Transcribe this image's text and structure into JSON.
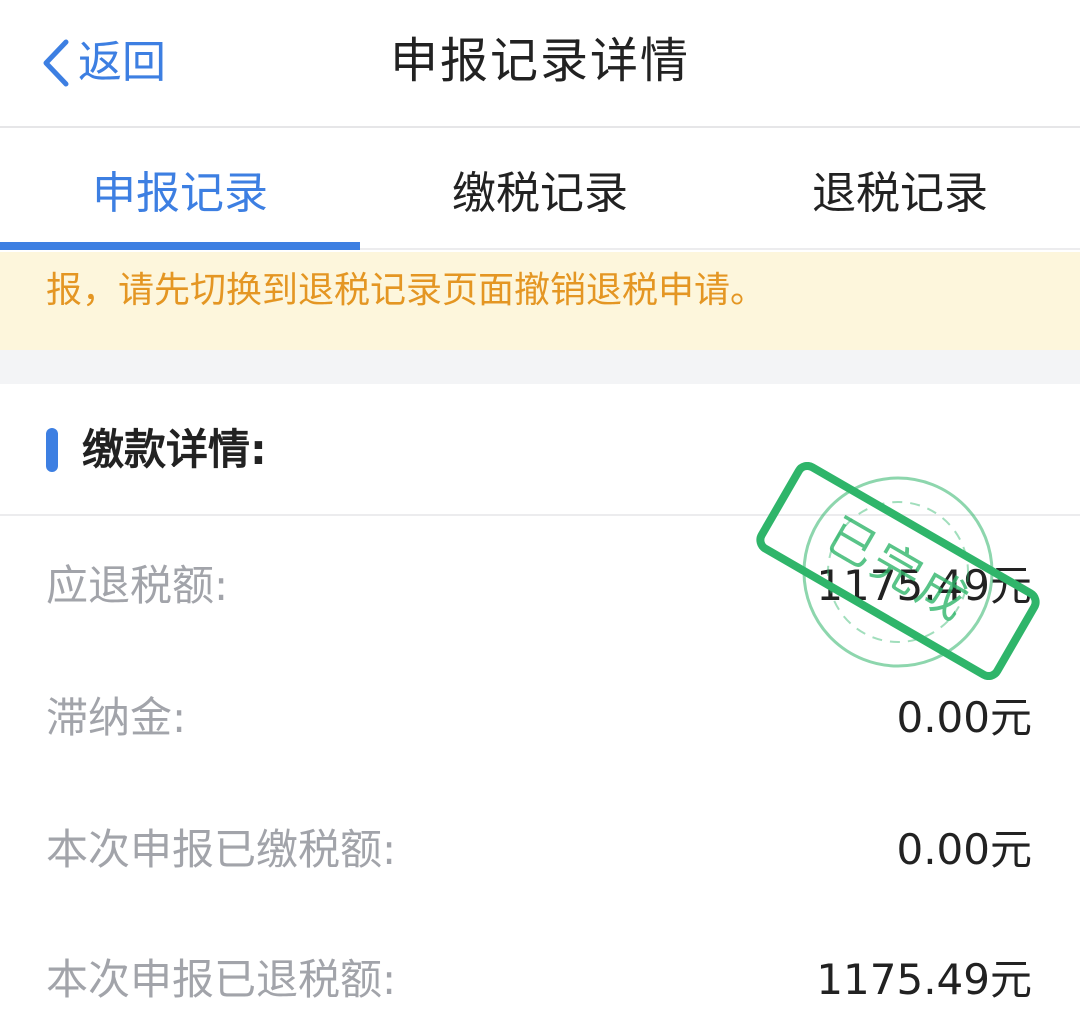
{
  "header": {
    "back_label": "返回",
    "title": "申报记录详情"
  },
  "tabs": [
    {
      "label": "申报记录",
      "active": true
    },
    {
      "label": "缴税记录",
      "active": false
    },
    {
      "label": "退税记录",
      "active": false
    }
  ],
  "notice": {
    "text": "报，请先切换到退税记录页面撤销退税申请。"
  },
  "section": {
    "title": "缴款详情:",
    "rows": [
      {
        "label": "应退税额:",
        "value": "1175.49元"
      },
      {
        "label": "滞纳金:",
        "value": "0.00元"
      },
      {
        "label": "本次申报已缴税额:",
        "value": "0.00元"
      },
      {
        "label": "本次申报已退税额:",
        "value": "1175.49元"
      }
    ]
  },
  "stamp": {
    "text": "已完成",
    "color": "#2fb56a"
  },
  "colors": {
    "accent": "#3d7fe2",
    "notice_text": "#e49623",
    "notice_bg": "#fdf6dc",
    "label_gray": "#a2a4aa"
  }
}
